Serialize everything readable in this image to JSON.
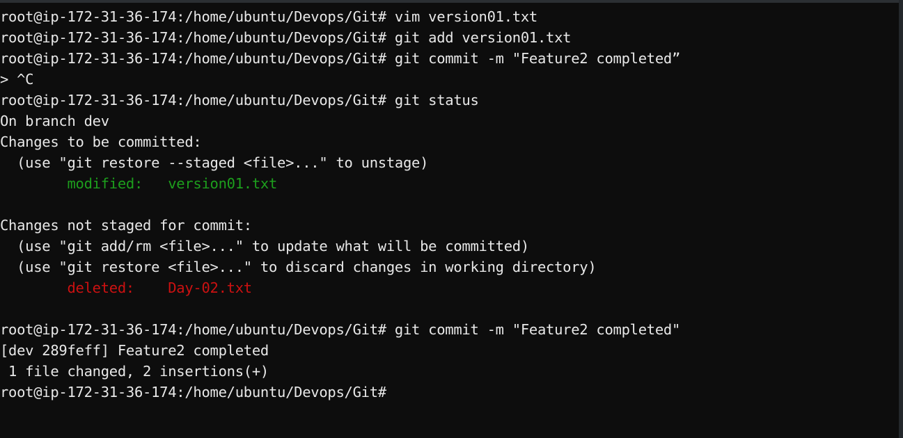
{
  "terminal": {
    "prompt": "root@ip-172-31-36-174:/home/ubuntu/Devops/Git#",
    "continuation_prompt": ">",
    "user": "root",
    "host": "ip-172-31-36-174",
    "cwd": "/home/ubuntu/Devops/Git",
    "branch": "dev",
    "commit_hash": "289feff",
    "background_color": "#0d0d0d",
    "foreground_color": "#e8e8e8",
    "staged_color": "#1d9e1d",
    "unstaged_color": "#cc1111",
    "lines": [
      {
        "segments": [
          {
            "text": "root@ip-172-31-36-174:/home/ubuntu/Devops/Git# vim version01.txt",
            "color": "default"
          }
        ]
      },
      {
        "segments": [
          {
            "text": "root@ip-172-31-36-174:/home/ubuntu/Devops/Git# git add version01.txt",
            "color": "default"
          }
        ]
      },
      {
        "segments": [
          {
            "text": "root@ip-172-31-36-174:/home/ubuntu/Devops/Git# git commit -m \"Feature2 completed”",
            "color": "default"
          }
        ]
      },
      {
        "segments": [
          {
            "text": "> ^C",
            "color": "default"
          }
        ]
      },
      {
        "segments": [
          {
            "text": "root@ip-172-31-36-174:/home/ubuntu/Devops/Git# git status",
            "color": "default"
          }
        ]
      },
      {
        "segments": [
          {
            "text": "On branch dev",
            "color": "default"
          }
        ]
      },
      {
        "segments": [
          {
            "text": "Changes to be committed:",
            "color": "default"
          }
        ]
      },
      {
        "segments": [
          {
            "text": "  (use \"git restore --staged <file>...\" to unstage)",
            "color": "default"
          }
        ]
      },
      {
        "segments": [
          {
            "text": "        modified:   version01.txt",
            "color": "green"
          }
        ]
      },
      {
        "segments": [
          {
            "text": "",
            "color": "default"
          }
        ]
      },
      {
        "segments": [
          {
            "text": "Changes not staged for commit:",
            "color": "default"
          }
        ]
      },
      {
        "segments": [
          {
            "text": "  (use \"git add/rm <file>...\" to update what will be committed)",
            "color": "default"
          }
        ]
      },
      {
        "segments": [
          {
            "text": "  (use \"git restore <file>...\" to discard changes in working directory)",
            "color": "default"
          }
        ]
      },
      {
        "segments": [
          {
            "text": "        deleted:    Day-02.txt",
            "color": "red"
          }
        ]
      },
      {
        "segments": [
          {
            "text": "",
            "color": "default"
          }
        ]
      },
      {
        "segments": [
          {
            "text": "root@ip-172-31-36-174:/home/ubuntu/Devops/Git# git commit -m \"Feature2 completed\"",
            "color": "default"
          }
        ]
      },
      {
        "segments": [
          {
            "text": "[dev 289feff] Feature2 completed",
            "color": "default"
          }
        ]
      },
      {
        "segments": [
          {
            "text": " 1 file changed, 2 insertions(+)",
            "color": "default"
          }
        ]
      },
      {
        "segments": [
          {
            "text": "root@ip-172-31-36-174:/home/ubuntu/Devops/Git#",
            "color": "default"
          }
        ]
      }
    ]
  }
}
